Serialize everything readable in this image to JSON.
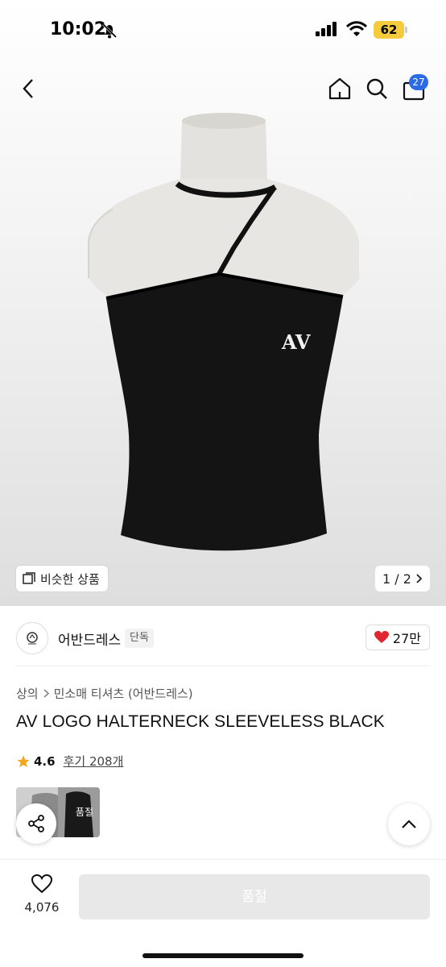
{
  "status_bar": {
    "time": "10:02",
    "battery": "62"
  },
  "nav": {
    "cart_count": "27"
  },
  "gallery": {
    "similar_label": "비슷한 상품",
    "pager": "1 / 2",
    "logo_mark": "AV"
  },
  "brand": {
    "name": "어반드레스",
    "exclusive_tag": "단독",
    "likes": "27만"
  },
  "product": {
    "breadcrumb": [
      "상의",
      "민소매 티셔츠 (어반드레스)"
    ],
    "title": "AV LOGO HALTERNECK SLEEVELESS BLACK",
    "rating": "4.6",
    "reviews": "후기 208개",
    "thumb_soldout": "품절"
  },
  "bottom": {
    "wish_count": "4,076",
    "cta_label": "품절"
  },
  "colors": {
    "accent_blue": "#2c6be6",
    "heart_red": "#e0262e",
    "star": "#f5a623"
  }
}
